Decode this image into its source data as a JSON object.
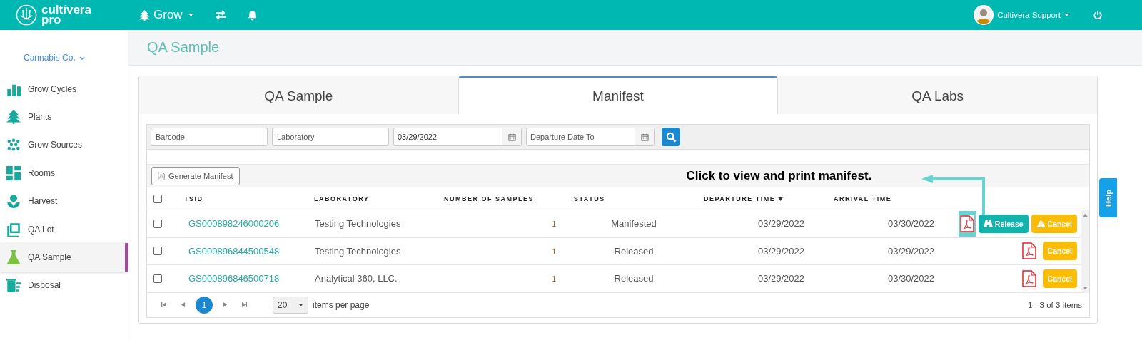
{
  "header": {
    "logo": [
      "cultívera",
      "pro"
    ],
    "module": "Grow",
    "user": "Cultivera Support"
  },
  "sidebar": {
    "company": "Cannabis Co.",
    "items": [
      {
        "label": "Grow Cycles",
        "kind": "bars",
        "selected": false
      },
      {
        "label": "Plants",
        "kind": "tree",
        "selected": false
      },
      {
        "label": "Grow Sources",
        "kind": "dots",
        "selected": false
      },
      {
        "label": "Rooms",
        "kind": "rooms",
        "selected": false
      },
      {
        "label": "Harvest",
        "kind": "harvest",
        "selected": false
      },
      {
        "label": "QA Lot",
        "kind": "lot",
        "selected": false
      },
      {
        "label": "QA Sample",
        "kind": "flask",
        "selected": true
      },
      {
        "label": "Disposal",
        "kind": "trash",
        "selected": false
      }
    ]
  },
  "page_title": "QA Sample",
  "tabs": [
    {
      "label": "QA Sample",
      "selected": false
    },
    {
      "label": "Manifest",
      "selected": true
    },
    {
      "label": "QA Labs",
      "selected": false
    }
  ],
  "filters": [
    {
      "kind": "text",
      "placeholder": "Barcode"
    },
    {
      "kind": "text",
      "placeholder": "Laboratory"
    },
    {
      "kind": "date",
      "value": "03/29/2022"
    },
    {
      "kind": "date",
      "placeholder": "Departure Date To"
    }
  ],
  "toolbar": {
    "generate_button": "Generate Manifest",
    "annotation": "Click to view and print manifest."
  },
  "table": {
    "header_checked": false,
    "columns": [
      {
        "label": "TSID",
        "sorted": false
      },
      {
        "label": "LABORATORY",
        "sorted": false
      },
      {
        "label": "NUMBER OF SAMPLES",
        "sorted": false
      },
      {
        "label": "STATUS",
        "sorted": false
      },
      {
        "label": "DEPARTURE TIME",
        "sorted": true
      },
      {
        "label": "ARRIVAL TIME",
        "sorted": false
      }
    ],
    "rows": [
      {
        "checked": false,
        "highlighted": true,
        "tsid": "GS000898246000206",
        "laboratory": "Testing Technologies",
        "samples": "1",
        "status": "Manifested",
        "departure": "03/29/2022",
        "arrival": "03/30/2022",
        "actions": [
          {
            "kind": "release",
            "label": "Release"
          },
          {
            "kind": "cancel",
            "label": "Cancel",
            "warning": true
          }
        ]
      },
      {
        "checked": false,
        "highlighted": false,
        "tsid": "GS000896844500548",
        "laboratory": "Testing Technologies",
        "samples": "1",
        "status": "Released",
        "departure": "03/29/2022",
        "arrival": "03/29/2022",
        "actions": [
          {
            "kind": "cancel",
            "label": "Cancel",
            "warning": false
          }
        ]
      },
      {
        "checked": false,
        "highlighted": false,
        "tsid": "GS000896846500718",
        "laboratory": "Analytical 360, LLC.",
        "samples": "1",
        "status": "Released",
        "departure": "03/29/2022",
        "arrival": "03/30/2022",
        "actions": [
          {
            "kind": "cancel",
            "label": "Cancel",
            "warning": false
          }
        ]
      }
    ]
  },
  "pager": {
    "pages": [
      {
        "label": "1",
        "selected": true
      }
    ],
    "page_size": "20",
    "page_size_label": "items per page",
    "summary": "1 - 3 of 3 items"
  },
  "help": "Help"
}
